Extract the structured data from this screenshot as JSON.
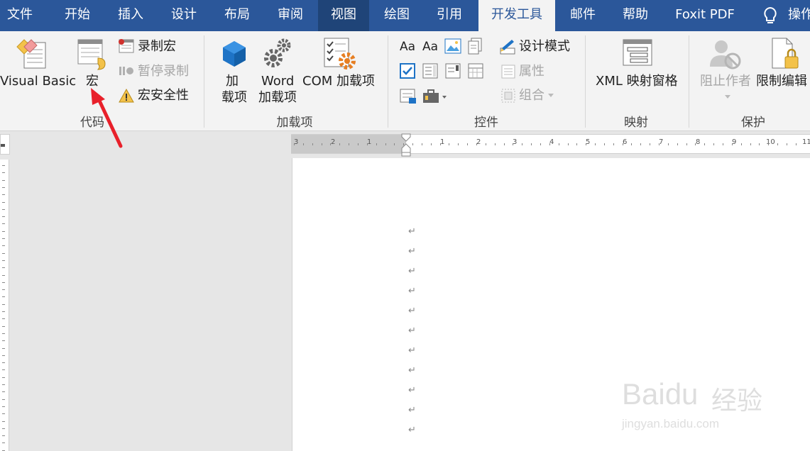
{
  "tabs": [
    {
      "label": "文件"
    },
    {
      "label": "开始"
    },
    {
      "label": "插入"
    },
    {
      "label": "设计"
    },
    {
      "label": "布局"
    },
    {
      "label": "审阅"
    },
    {
      "label": "视图"
    },
    {
      "label": "绘图"
    },
    {
      "label": "引用"
    },
    {
      "label": "开发工具"
    },
    {
      "label": "邮件"
    },
    {
      "label": "帮助"
    },
    {
      "label": "Foxit PDF"
    },
    {
      "label": "操作"
    }
  ],
  "groups": {
    "code": {
      "label": "代码",
      "visual_basic": "Visual Basic",
      "macros": "宏",
      "record_macro": "录制宏",
      "pause_recording": "暂停录制",
      "macro_security": "宏安全性"
    },
    "addins": {
      "label": "加载项",
      "addins_line1": "加",
      "addins_line2": "载项",
      "word_line1": "Word",
      "word_line2": "加载项",
      "com_addins": "COM 加载项"
    },
    "controls": {
      "label": "控件",
      "text_aa1": "Aa",
      "text_aa2": "Aa",
      "design_mode": "设计模式",
      "properties": "属性",
      "group": "组合"
    },
    "mapping": {
      "label": "映射",
      "xml_pane": "XML 映射窗格"
    },
    "protect": {
      "label": "保护",
      "block_authors": "阻止作者",
      "restrict_editing": "限制编辑"
    }
  },
  "ruler": {
    "numbers": [
      "3",
      "2",
      "1",
      "1",
      "2",
      "3",
      "4",
      "5",
      "6",
      "7",
      "8",
      "9",
      "10",
      "11"
    ]
  },
  "watermark": {
    "brand": "Baidu",
    "cn": "经验",
    "url": "jingyan.baidu.com"
  },
  "colors": {
    "accent": "#2b579a",
    "arrow": "#e8202a"
  }
}
